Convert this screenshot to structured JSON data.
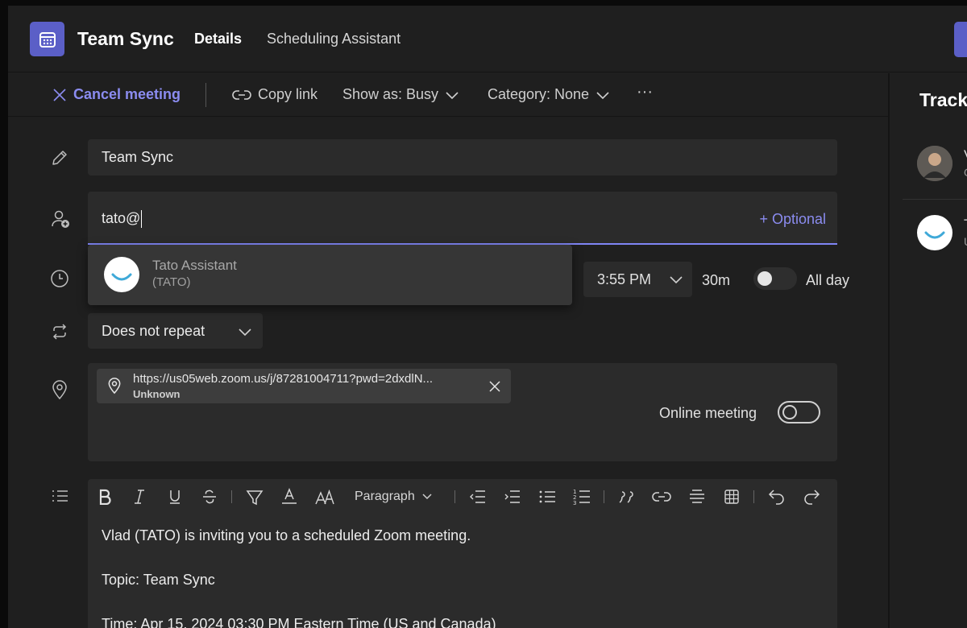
{
  "header": {
    "title": "Team Sync",
    "tabs": [
      {
        "label": "Details",
        "active": true
      },
      {
        "label": "Scheduling Assistant",
        "active": false
      }
    ],
    "accent_color": "#5b5fc7"
  },
  "toolbar": {
    "cancel_label": "Cancel meeting",
    "copy_link_label": "Copy link",
    "show_as_label": "Show as: Busy",
    "category_label": "Category: None",
    "more_label": "···"
  },
  "form": {
    "title_value": "Team Sync",
    "attendee_input_value": "tato@",
    "optional_label": "+ Optional",
    "suggestion": {
      "name": "Tato Assistant",
      "subtitle": "(TATO)"
    },
    "end_time": "3:55 PM",
    "duration": "30m",
    "all_day_label": "All day",
    "all_day_on": false,
    "repeat_value": "Does not repeat",
    "location": {
      "url": "https://us05web.zoom.us/j/87281004711?pwd=2dxdlN...",
      "status": "Unknown"
    },
    "online_meeting_label": "Online meeting",
    "online_meeting_on": false
  },
  "editor": {
    "paragraph_style": "Paragraph",
    "body_lines": [
      "Vlad (TATO) is inviting you to a scheduled Zoom meeting.",
      "Topic: Team Sync",
      "Time: Apr 15, 2024 03:30 PM Eastern Time (US and Canada)"
    ]
  },
  "right_pane": {
    "title": "Track",
    "attendees": [
      {
        "initial": "V",
        "sub": "O"
      },
      {
        "initial": "T",
        "sub": "U"
      }
    ]
  }
}
